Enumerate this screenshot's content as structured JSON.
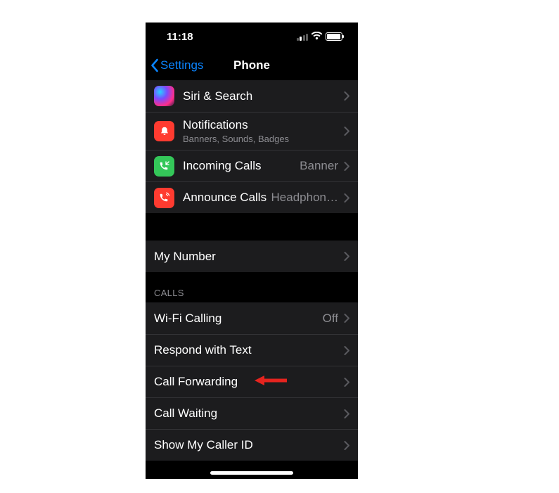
{
  "status": {
    "time": "11:18"
  },
  "nav": {
    "back_label": "Settings",
    "title": "Phone"
  },
  "section1": {
    "items": [
      {
        "label": "Siri & Search"
      },
      {
        "label": "Notifications",
        "sub": "Banners, Sounds, Badges"
      },
      {
        "label": "Incoming Calls",
        "detail": "Banner"
      },
      {
        "label": "Announce Calls",
        "detail": "Headphon…"
      }
    ]
  },
  "section2": {
    "items": [
      {
        "label": "My Number"
      }
    ]
  },
  "section3": {
    "header": "CALLS",
    "items": [
      {
        "label": "Wi-Fi Calling",
        "detail": "Off"
      },
      {
        "label": "Respond with Text"
      },
      {
        "label": "Call Forwarding"
      },
      {
        "label": "Call Waiting"
      },
      {
        "label": "Show My Caller ID"
      }
    ]
  },
  "colors": {
    "accent": "#0a84ff",
    "row_bg": "#1c1c1e",
    "text_secondary": "#8d8d92",
    "annotation": "#e6241f"
  },
  "annotation": {
    "target_label": "Call Forwarding"
  }
}
